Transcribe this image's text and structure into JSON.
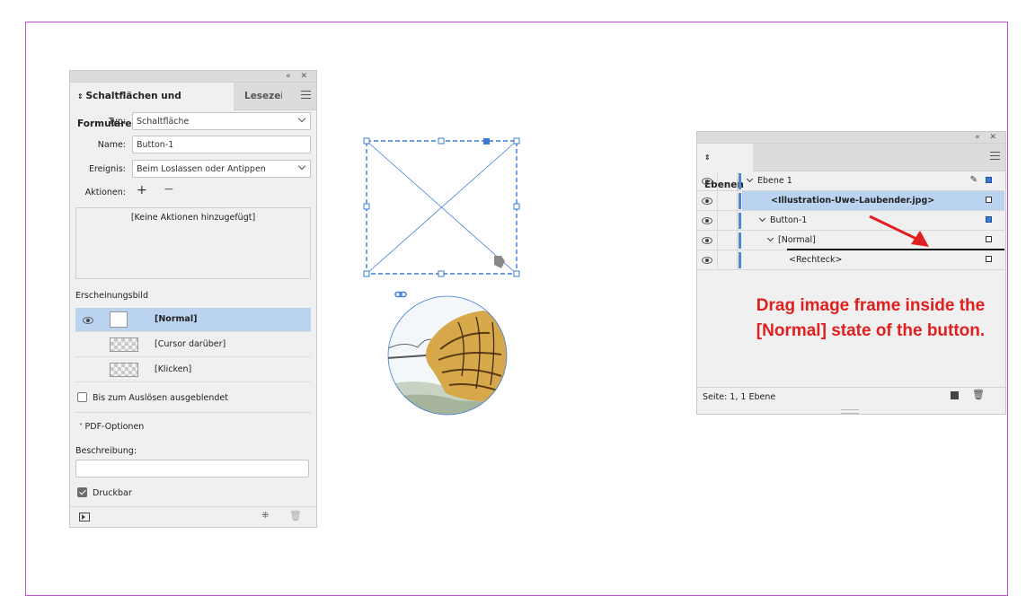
{
  "buttons_panel": {
    "tab_active": "Schaltflächen und Formulare",
    "tab_inactive": "Lesezeic",
    "typ_label": "Typ:",
    "typ_value": "Schaltfläche",
    "name_label": "Name:",
    "name_value": "Button-1",
    "ereignis_label": "Ereignis:",
    "ereignis_value": "Beim Loslassen oder Antippen",
    "aktionen_label": "Aktionen:",
    "aktionen_empty": "[Keine Aktionen hinzugefügt]",
    "erscheinungsbild_label": "Erscheinungsbild",
    "states": [
      {
        "label": "[Normal]"
      },
      {
        "label": "[Cursor darüber]"
      },
      {
        "label": "[Klicken]"
      }
    ],
    "hidden_until_trigger": "Bis zum Auslösen ausgeblendet",
    "pdf_options": "PDF-Optionen",
    "beschreibung_label": "Beschreibung:",
    "druckbar_label": "Druckbar"
  },
  "layers_panel": {
    "tab_label": "Ebenen",
    "rows": [
      {
        "name": "Ebene 1"
      },
      {
        "name": "<Illustration-Uwe-Laubender.jpg>"
      },
      {
        "name": "Button-1"
      },
      {
        "name": "[Normal]"
      },
      {
        "name": "<Rechteck>"
      }
    ],
    "status": "Seite: 1, 1 Ebene"
  },
  "annotation": {
    "text": "Drag image frame inside the [Normal] state of the button.",
    "color": "#e02020"
  },
  "colors": {
    "selection": "#b9d3f0",
    "frame_blue": "#3a7bd5",
    "page_border": "#c04fd8"
  }
}
